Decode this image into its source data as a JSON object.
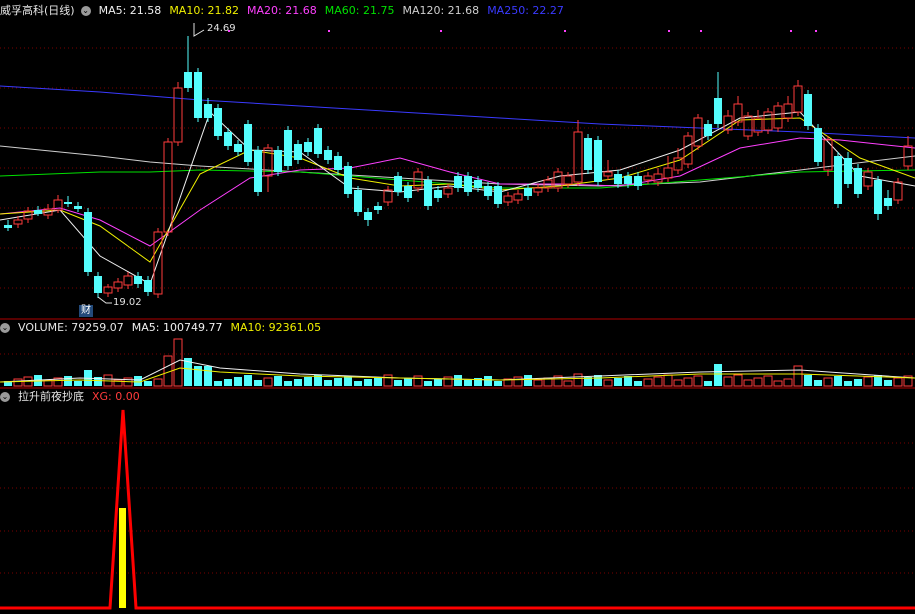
{
  "header": {
    "stock_name": "威孚高科(日线)",
    "ma5": "MA5: 21.58",
    "ma10": "MA10: 21.82",
    "ma20": "MA20: 21.68",
    "ma60": "MA60: 21.75",
    "ma120": "MA120: 21.68",
    "ma250": "MA250: 22.27"
  },
  "price_markers": {
    "high_label": "24.69",
    "low_label": "19.02",
    "event_badge": "财"
  },
  "volume_header": {
    "volume": "VOLUME: 79259.07",
    "ma5": "MA5: 100749.77",
    "ma10": "MA10: 92361.05"
  },
  "indicator_header": {
    "name": "拉升前夜抄底",
    "xg": "XG: 0.00"
  },
  "colors": {
    "up": "#ff3b3b",
    "down": "#54fcfc",
    "ma5": "#f0f0f0",
    "ma10": "#f0f000",
    "ma20": "#ff40ff",
    "ma60": "#00e000",
    "ma120": "#cfcfcf",
    "ma250": "#3a3aff",
    "grid": "#7a0000",
    "signal": "#ff0000",
    "signal_bar": "#ffff00"
  }
}
